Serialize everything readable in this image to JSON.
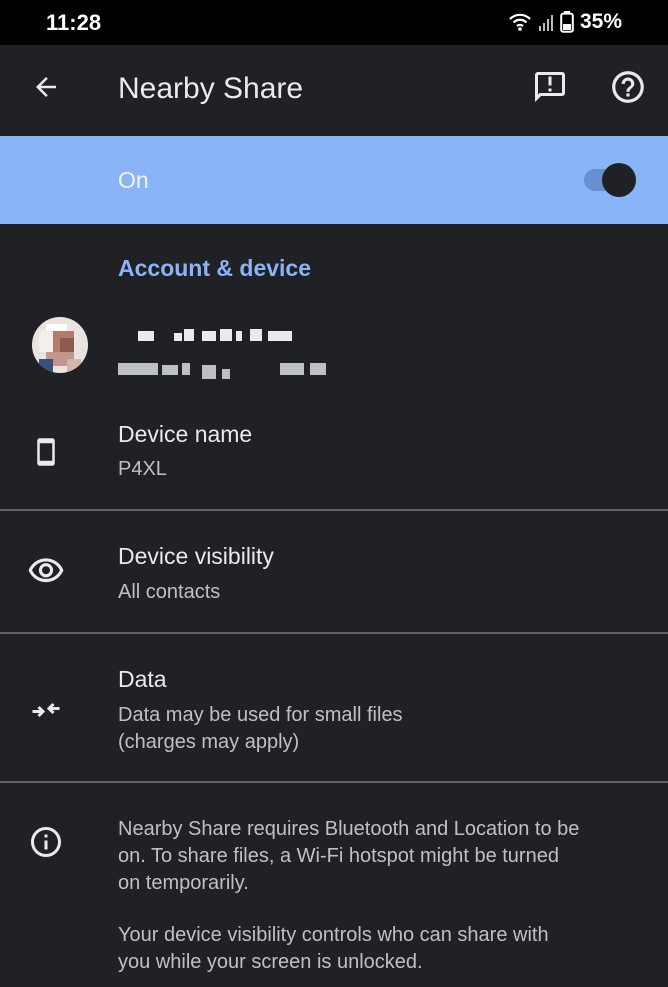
{
  "status_bar": {
    "time": "11:28",
    "battery": "35%",
    "icons": [
      "wifi-icon",
      "signal-icon",
      "battery-icon"
    ]
  },
  "app_bar": {
    "title": "Nearby Share",
    "icons": [
      "back-arrow-icon",
      "feedback-icon",
      "help-icon"
    ]
  },
  "toggle": {
    "label": "On",
    "checked": true
  },
  "section": {
    "header": "Account & device"
  },
  "items": [
    {
      "icon": "phone-icon",
      "title": "Device name",
      "subtitle": "P4XL"
    },
    {
      "icon": "eye-icon",
      "title": "Device visibility",
      "subtitle": "All contacts"
    },
    {
      "icon": "data-arrows-icon",
      "title": "Data",
      "subtitle_line1": "Data may be used for small files",
      "subtitle_line2": "(charges may apply)"
    }
  ],
  "info": {
    "icon": "info-icon",
    "para1_line1": "Nearby Share requires Bluetooth and Location to be",
    "para1_line2": "on. To share files, a Wi-Fi hotspot might be turned",
    "para1_line3": "on temporarily.",
    "para2_line1": "Your device visibility controls who can share with",
    "para2_line2": "you while your screen is unlocked."
  },
  "colors": {
    "background": "#202124",
    "accent": "#8ab4f8",
    "divider": "#5f6368"
  }
}
